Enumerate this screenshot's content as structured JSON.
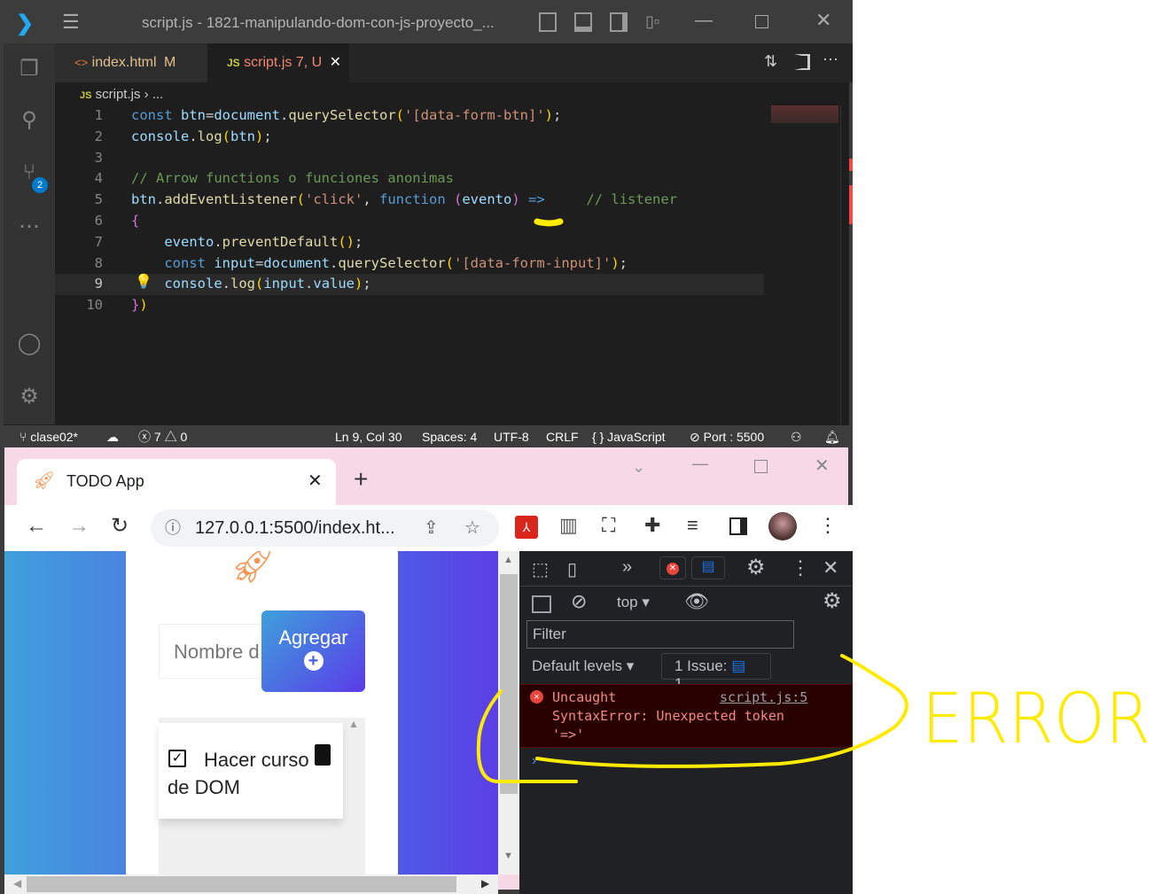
{
  "vscode": {
    "title": "script.js - 1821-manipulando-dom-con-js-proyecto_...",
    "tabs": [
      {
        "icon": "<>",
        "label": "index.html",
        "badge": "M"
      },
      {
        "icon": "JS",
        "label": "script.js",
        "badge": "7, U",
        "close": "✕"
      }
    ],
    "breadcrumb": {
      "icon": "JS",
      "file": "script.js",
      "sep": "›",
      "rest": "..."
    },
    "scm_badge": "2",
    "code": [
      [
        [
          "const ",
          "k"
        ],
        [
          "btn",
          "v"
        ],
        [
          "=",
          "p"
        ],
        [
          "document",
          "v"
        ],
        [
          ".",
          "p"
        ],
        [
          "querySelector",
          "f"
        ],
        [
          "(",
          "b"
        ],
        [
          "'[data-form-btn]'",
          "s"
        ],
        [
          ")",
          "b"
        ],
        [
          ";",
          "p"
        ]
      ],
      [
        [
          "console",
          "v"
        ],
        [
          ".",
          "p"
        ],
        [
          "log",
          "f"
        ],
        [
          "(",
          "b"
        ],
        [
          "btn",
          "v"
        ],
        [
          ")",
          "b"
        ],
        [
          ";",
          "p"
        ]
      ],
      [],
      [
        [
          "// Arrow functions o funciones anonimas",
          "c"
        ]
      ],
      [
        [
          "btn",
          "v"
        ],
        [
          ".",
          "p"
        ],
        [
          "addEventListener",
          "f"
        ],
        [
          "(",
          "b"
        ],
        [
          "'click'",
          "s"
        ],
        [
          ", ",
          "p"
        ],
        [
          "function",
          "k"
        ],
        [
          " ",
          "p"
        ],
        [
          "(",
          "m"
        ],
        [
          "evento",
          "v"
        ],
        [
          ")",
          "m"
        ],
        [
          " ",
          "p"
        ],
        [
          "=>",
          "k"
        ],
        [
          "     ",
          "p"
        ],
        [
          "// listener",
          "c"
        ]
      ],
      [
        [
          "{",
          "m"
        ]
      ],
      [
        [
          "    ",
          "p"
        ],
        [
          "evento",
          "v"
        ],
        [
          ".",
          "p"
        ],
        [
          "preventDefault",
          "f"
        ],
        [
          "()",
          "b"
        ],
        [
          ";",
          "p"
        ]
      ],
      [
        [
          "    ",
          "p"
        ],
        [
          "const ",
          "k"
        ],
        [
          "input",
          "v"
        ],
        [
          "=",
          "p"
        ],
        [
          "document",
          "v"
        ],
        [
          ".",
          "p"
        ],
        [
          "querySelector",
          "f"
        ],
        [
          "(",
          "b"
        ],
        [
          "'[data-form-input]'",
          "s"
        ],
        [
          ")",
          "b"
        ],
        [
          ";",
          "p"
        ]
      ],
      [
        [
          "    ",
          "p"
        ],
        [
          "console",
          "v"
        ],
        [
          ".",
          "p"
        ],
        [
          "log",
          "f"
        ],
        [
          "(",
          "b"
        ],
        [
          "input",
          "v"
        ],
        [
          ".",
          "p"
        ],
        [
          "value",
          "v"
        ],
        [
          ")",
          "b"
        ],
        [
          ";",
          "p"
        ]
      ],
      [
        [
          "}",
          "m"
        ],
        [
          ")",
          "b"
        ]
      ]
    ],
    "status": {
      "branch": "clase02*",
      "errors": "7",
      "warnings": "0",
      "position": "Ln 9, Col 30",
      "spaces": "Spaces: 4",
      "encoding": "UTF-8",
      "eol": "CRLF",
      "language": "JavaScript",
      "port": "Port : 5500"
    }
  },
  "browser": {
    "tab_title": "TODO App",
    "url": "127.0.0.1:5500/index.ht...",
    "page": {
      "input_placeholder": "Nombre d",
      "add_button": "Agregar",
      "task_text": "Hacer curso de DOM"
    },
    "devtools": {
      "context": "top",
      "filter_placeholder": "Filter",
      "levels": "Default levels",
      "issues_label": "1 Issue:",
      "issues_count": "1",
      "error_title": "Uncaught",
      "error_source": "script.js:5",
      "error_message": "SyntaxError: Unexpected token '=>'"
    }
  },
  "annotation": {
    "text": "ERROR",
    "color": "#ffeb00"
  },
  "colors": {
    "accent_error": "#f28b82",
    "vscode_blue": "#007acc",
    "devtools_error_bg": "#290000"
  }
}
